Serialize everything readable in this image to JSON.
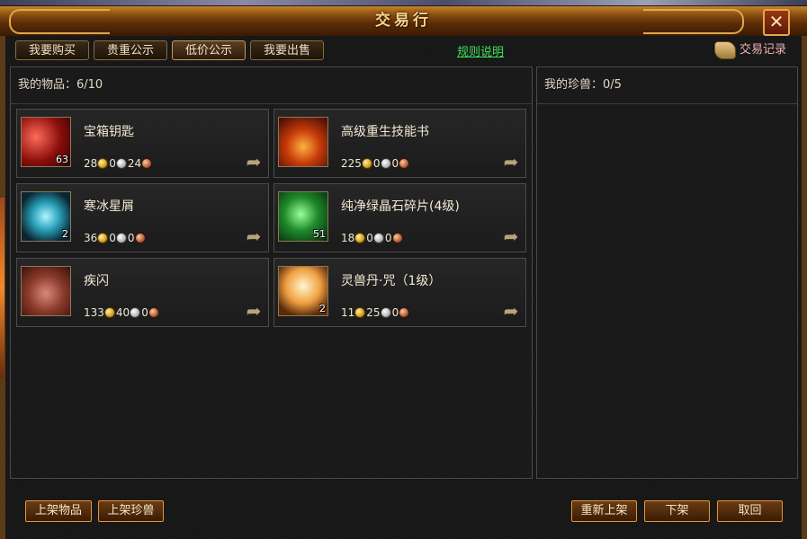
{
  "window": {
    "title": "交易行",
    "close_glyph": "✕"
  },
  "tabs": [
    {
      "label": "我要购买"
    },
    {
      "label": "贵重公示"
    },
    {
      "label": "低价公示"
    },
    {
      "label": "我要出售"
    }
  ],
  "rules_link": "规则说明",
  "records_label": "交易记录",
  "items_panel": {
    "header": "我的物品：6/10"
  },
  "pets_panel": {
    "header": "我的珍兽：0/5"
  },
  "items": [
    {
      "name": "宝箱钥匙",
      "icon": "key-icon",
      "qty": "63",
      "gold": "28",
      "silver": "0",
      "copper": "24"
    },
    {
      "name": "高级重生技能书",
      "icon": "skill-book-icon",
      "qty": "",
      "gold": "225",
      "silver": "0",
      "copper": "0"
    },
    {
      "name": "寒冰星屑",
      "icon": "ice-shard-icon",
      "qty": "2",
      "gold": "36",
      "silver": "0",
      "copper": "0"
    },
    {
      "name": "纯净绿晶石碎片(4级)",
      "icon": "green-crystal-icon",
      "qty": "51",
      "gold": "18",
      "silver": "0",
      "copper": "0"
    },
    {
      "name": "疾闪",
      "icon": "dash-skill-icon",
      "qty": "",
      "gold": "133",
      "silver": "40",
      "copper": "0"
    },
    {
      "name": "灵兽丹·咒（1级）",
      "icon": "crystal-orb-icon",
      "qty": "2",
      "gold": "11",
      "silver": "25",
      "copper": "0"
    }
  ],
  "share_glyph": "➦",
  "buttons": {
    "list_item": "上架物品",
    "list_pet": "上架珍兽",
    "relist": "重新上架",
    "delist": "下架",
    "withdraw": "取回"
  }
}
